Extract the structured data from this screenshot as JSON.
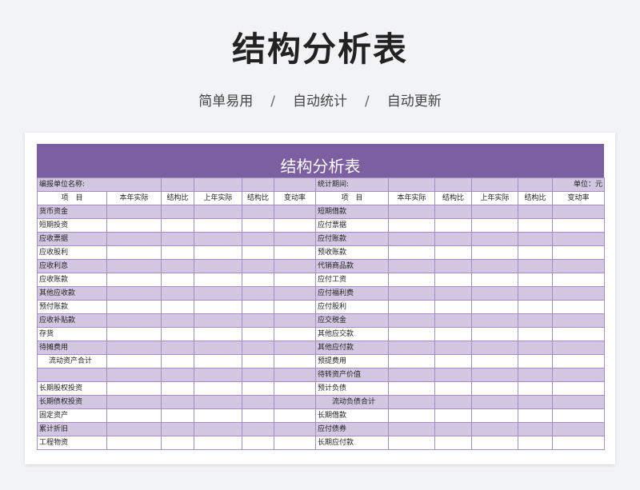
{
  "header": {
    "title": "结构分析表",
    "tags": [
      "简单易用",
      "自动统计",
      "自动更新"
    ],
    "separator": "/"
  },
  "sheet": {
    "banner_title": "结构分析表",
    "info": {
      "unit_name_label": "编报单位名称:",
      "period_label": "统计期间:",
      "unit_label": "单位：元"
    },
    "columns": [
      "项　目",
      "本年实际",
      "结构比",
      "上年实际",
      "结构比",
      "变动率"
    ],
    "left_items": [
      "货币资金",
      "短期投资",
      "应收票据",
      "应收股利",
      "应收利息",
      "应收账款",
      "其他应收款",
      "预付账款",
      "应收补贴款",
      "存货",
      "待摊费用",
      "流动资产合计",
      "",
      "长期股权投资",
      "长期债权投资",
      "固定资产",
      "累计折旧",
      "工程物资"
    ],
    "right_items": [
      "短期借款",
      "应付票据",
      "应付账款",
      "预收账款",
      "代销商品款",
      "应付工资",
      "应付福利费",
      "应付股利",
      "应交税金",
      "其他应交款",
      "其他应付款",
      "预提费用",
      "待转资产价值",
      "预计负债",
      "流动负债合计",
      "长期借款",
      "应付债券",
      "长期应付款"
    ]
  }
}
